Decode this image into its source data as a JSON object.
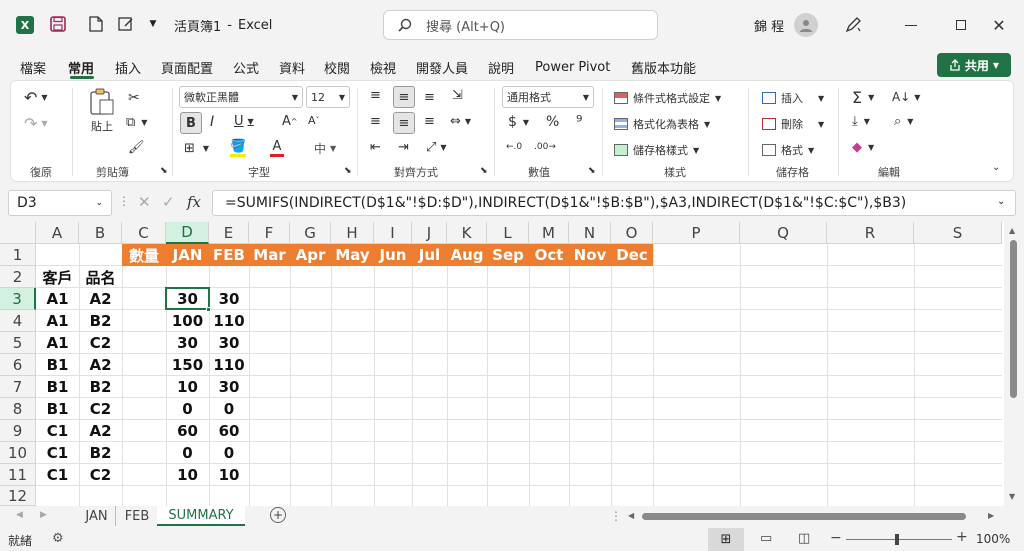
{
  "window": {
    "doc_name": "活頁簿1",
    "separator": "-",
    "app_name": "Excel",
    "user_name": "錦 程"
  },
  "search": {
    "placeholder": "搜尋 (Alt+Q)"
  },
  "menu_tabs": [
    {
      "label": "檔案",
      "active": false
    },
    {
      "label": "常用",
      "active": true
    },
    {
      "label": "插入",
      "active": false
    },
    {
      "label": "頁面配置",
      "active": false
    },
    {
      "label": "公式",
      "active": false
    },
    {
      "label": "資料",
      "active": false
    },
    {
      "label": "校閱",
      "active": false
    },
    {
      "label": "檢視",
      "active": false
    },
    {
      "label": "開發人員",
      "active": false
    },
    {
      "label": "說明",
      "active": false
    },
    {
      "label": "Power Pivot",
      "active": false
    },
    {
      "label": "舊版本功能",
      "active": false
    }
  ],
  "share_label": "共用",
  "ribbon": {
    "groups": [
      "復原",
      "剪貼簿",
      "字型",
      "對齊方式",
      "數值",
      "樣式",
      "儲存格",
      "編輯"
    ],
    "paste_label": "貼上",
    "font_name": "微軟正黑體",
    "font_size": "12",
    "number_format": "通用格式",
    "conditional_format": "條件式格式設定",
    "format_as_table": "格式化為表格",
    "cell_styles": "儲存格樣式",
    "insert": "插入",
    "delete": "刪除",
    "format": "格式"
  },
  "formula_bar": {
    "name_box": "D3",
    "fx": "fx",
    "formula": "=SUMIFS(INDIRECT(D$1&\"!$D:$D\"),INDIRECT(D$1&\"!$B:$B\"),$A3,INDIRECT(D$1&\"!$C:$C\"),$B3)"
  },
  "columns": [
    "A",
    "B",
    "C",
    "D",
    "E",
    "F",
    "G",
    "H",
    "I",
    "J",
    "K",
    "L",
    "M",
    "N",
    "O",
    "P",
    "Q",
    "R",
    "S"
  ],
  "rows": [
    "1",
    "2",
    "3",
    "4",
    "5",
    "6",
    "7",
    "8",
    "9",
    "10",
    "11",
    "12"
  ],
  "header_row": [
    "數量",
    "JAN",
    "FEB",
    "Mar",
    "Apr",
    "May",
    "Jun",
    "Jul",
    "Aug",
    "Sep",
    "Oct",
    "Nov",
    "Dec"
  ],
  "col_headers": [
    "客戶",
    "品名"
  ],
  "table": [
    [
      "A1",
      "A2",
      "30",
      "30"
    ],
    [
      "A1",
      "B2",
      "100",
      "110"
    ],
    [
      "A1",
      "C2",
      "30",
      "30"
    ],
    [
      "B1",
      "A2",
      "150",
      "110"
    ],
    [
      "B1",
      "B2",
      "10",
      "30"
    ],
    [
      "B1",
      "C2",
      "0",
      "0"
    ],
    [
      "C1",
      "A2",
      "60",
      "60"
    ],
    [
      "C1",
      "B2",
      "0",
      "0"
    ],
    [
      "C1",
      "C2",
      "10",
      "10"
    ]
  ],
  "sheets": [
    {
      "label": "JAN",
      "active": false
    },
    {
      "label": "FEB",
      "active": false
    },
    {
      "label": "SUMMARY",
      "active": true
    }
  ],
  "status": {
    "ready": "就緒",
    "zoom": "100%"
  },
  "colors": {
    "accent": "#217346",
    "header_fill": "#ed7d31"
  }
}
